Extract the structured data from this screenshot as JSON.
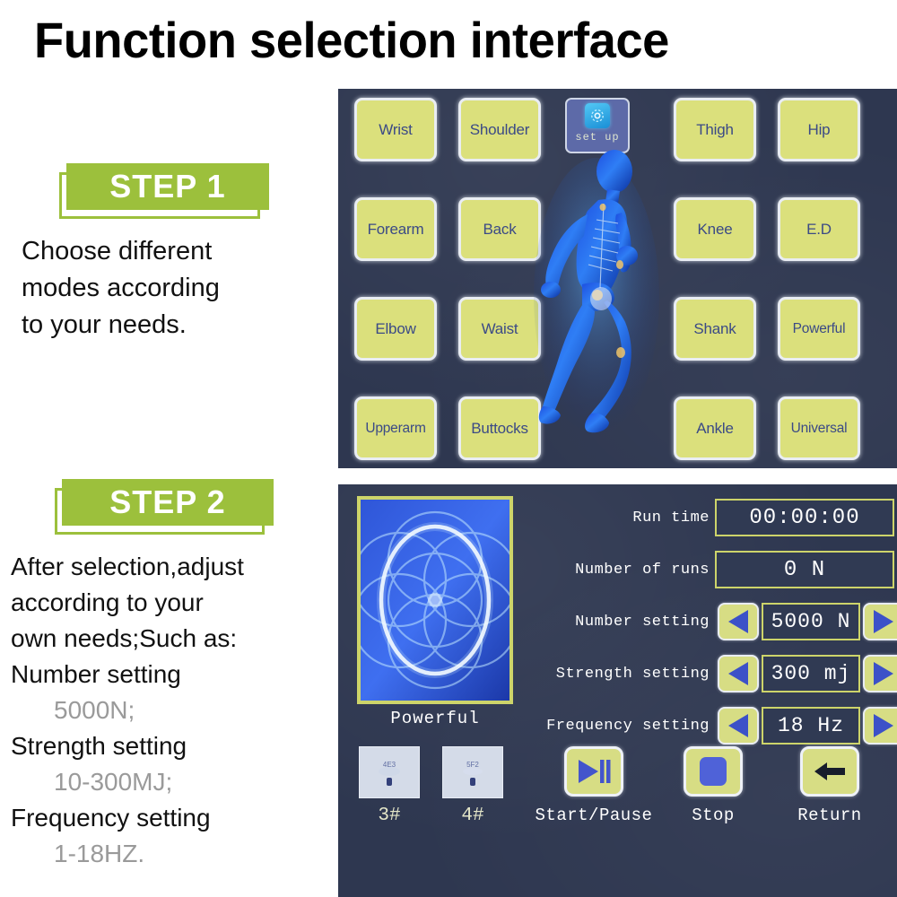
{
  "page": {
    "title": "Function selection interface"
  },
  "colors": {
    "accent_green": "#9cc03c",
    "screen_background": "#2e3750",
    "button_yellow": "#dbe07c",
    "button_text_blue": "#3b4a86",
    "value_border_yellow": "#cdd46a",
    "arrow_blue": "#3c51c8",
    "muted_gray": "#9a9a9a"
  },
  "step1": {
    "badge": "STEP 1",
    "description_lines": [
      "Choose different",
      "modes according",
      "to your needs."
    ]
  },
  "step2": {
    "badge": "STEP 2",
    "description_lines": [
      "After selection,adjust",
      "according to your",
      "own needs;Such as:",
      "Number setting"
    ],
    "value_line_1": "5000N;",
    "line_5": "Strength setting",
    "value_line_2": "10-300MJ;",
    "line_6": "Frequency setting",
    "value_line_3": "1-18HZ."
  },
  "screen_functions": {
    "left_buttons": [
      {
        "label": "Wrist"
      },
      {
        "label": "Shoulder"
      },
      {
        "label": "Forearm"
      },
      {
        "label": "Back"
      },
      {
        "label": "Elbow"
      },
      {
        "label": "Waist"
      },
      {
        "label": "Upperarm"
      },
      {
        "label": "Buttocks"
      }
    ],
    "right_buttons": [
      {
        "label": "Thigh"
      },
      {
        "label": "Hip"
      },
      {
        "label": "Knee"
      },
      {
        "label": "E.D"
      },
      {
        "label": "Shank"
      },
      {
        "label": "Powerful"
      },
      {
        "label": "Ankle"
      },
      {
        "label": "Universal"
      }
    ],
    "setup_button": {
      "label": "set up",
      "icon": "gear-icon"
    },
    "figure": {
      "icon": "anatomy-running-figure"
    }
  },
  "screen_settings": {
    "preview": {
      "label": "Powerful",
      "icon": "energy-pattern-image"
    },
    "probe_buttons": [
      {
        "caption": "3#",
        "icon": "probe-head-3-icon"
      },
      {
        "caption": "4#",
        "icon": "probe-head-4-icon"
      }
    ],
    "rows": [
      {
        "label": "Run time",
        "value": "00:00:00",
        "has_arrows": false
      },
      {
        "label": "Number of runs",
        "value": "0   N",
        "has_arrows": false
      },
      {
        "label": "Number setting",
        "value": "5000 N",
        "has_arrows": true
      },
      {
        "label": "Strength setting",
        "value": "300 mj",
        "has_arrows": true
      },
      {
        "label": "Frequency setting",
        "value": "18 Hz",
        "has_arrows": true
      }
    ],
    "actions": [
      {
        "caption": "Start/Pause",
        "icon": "play-pause-icon"
      },
      {
        "caption": "Stop",
        "icon": "stop-square-icon"
      },
      {
        "caption": "Return",
        "icon": "arrow-left-icon"
      }
    ]
  }
}
